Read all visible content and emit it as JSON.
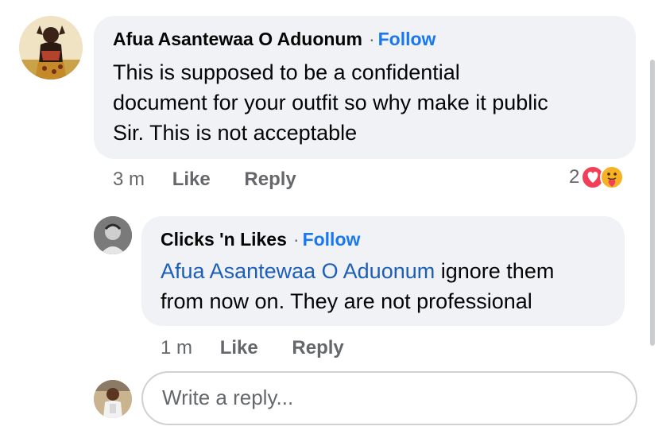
{
  "comment": {
    "author": "Afua Asantewaa O Aduonum",
    "separator": "·",
    "follow": "Follow",
    "text": [
      "This is supposed to be a confidential",
      "document for your outfit so why make it public",
      "Sir. This is not acceptable"
    ],
    "time": "3 m",
    "like": "Like",
    "reply": "Reply",
    "reaction_count": "2",
    "reactions": [
      "love-icon",
      "care-icon"
    ]
  },
  "reply_comment": {
    "author": "Clicks 'n Likes",
    "separator": "·",
    "follow": "Follow",
    "mention": "Afua Asantewaa O Aduonum",
    "text_line1_rest": " ignore them",
    "text_line2": "from now on. They are not professional",
    "time": "1 m",
    "like": "Like",
    "reply": "Reply"
  },
  "reply_input": {
    "placeholder": "Write a reply..."
  },
  "colors": {
    "bubble": "#f0f2f5",
    "follow": "#1877f2",
    "mention": "#1d5fb8",
    "meta": "#65676b",
    "love": "#f33e58",
    "care": "#f7b125"
  }
}
